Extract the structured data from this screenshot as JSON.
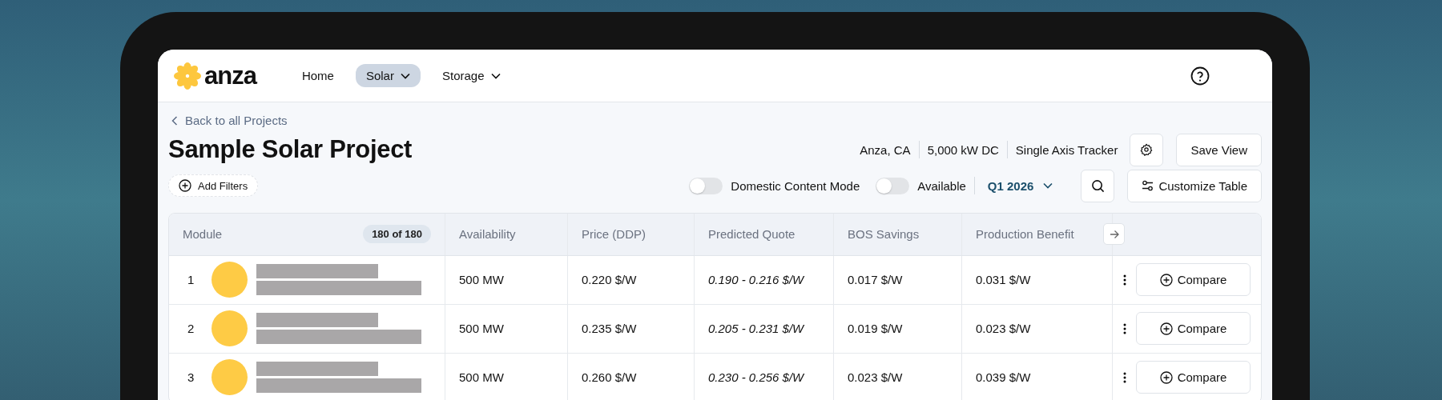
{
  "nav": {
    "logo": "anza",
    "items": [
      {
        "label": "Home",
        "selected": false,
        "dropdown": false
      },
      {
        "label": "Solar",
        "selected": true,
        "dropdown": true
      },
      {
        "label": "Storage",
        "selected": false,
        "dropdown": true
      }
    ]
  },
  "back_link": "Back to all Projects",
  "title": "Sample Solar Project",
  "project_meta": [
    "Anza, CA",
    "5,000 kW DC",
    "Single Axis Tracker"
  ],
  "save_view": "Save View",
  "add_filters": "Add Filters",
  "toggles": [
    {
      "label": "Domestic Content Mode",
      "on": false
    },
    {
      "label": "Available",
      "on": false
    }
  ],
  "quarter": "Q1 2026",
  "customize_table": "Customize Table",
  "table": {
    "module_column": "Module",
    "count_badge": "180 of 180",
    "columns": [
      "Availability",
      "Price (DDP)",
      "Predicted Quote",
      "BOS Savings",
      "Production Benefit"
    ],
    "rows": [
      {
        "rank": "1",
        "cells": [
          "500 MW",
          "0.220 $/W",
          "0.190 - 0.216 $/W",
          "0.017 $/W",
          "0.031 $/W"
        ],
        "compare_label": "Compare"
      },
      {
        "rank": "2",
        "cells": [
          "500 MW",
          "0.235 $/W",
          "0.205 - 0.231 $/W",
          "0.019 $/W",
          "0.023 $/W"
        ],
        "compare_label": "Compare"
      },
      {
        "rank": "3",
        "cells": [
          "500 MW",
          "0.260 $/W",
          "0.230 - 0.256 $/W",
          "0.023 $/W",
          "0.039 $/W"
        ],
        "compare_label": "Compare"
      }
    ]
  }
}
